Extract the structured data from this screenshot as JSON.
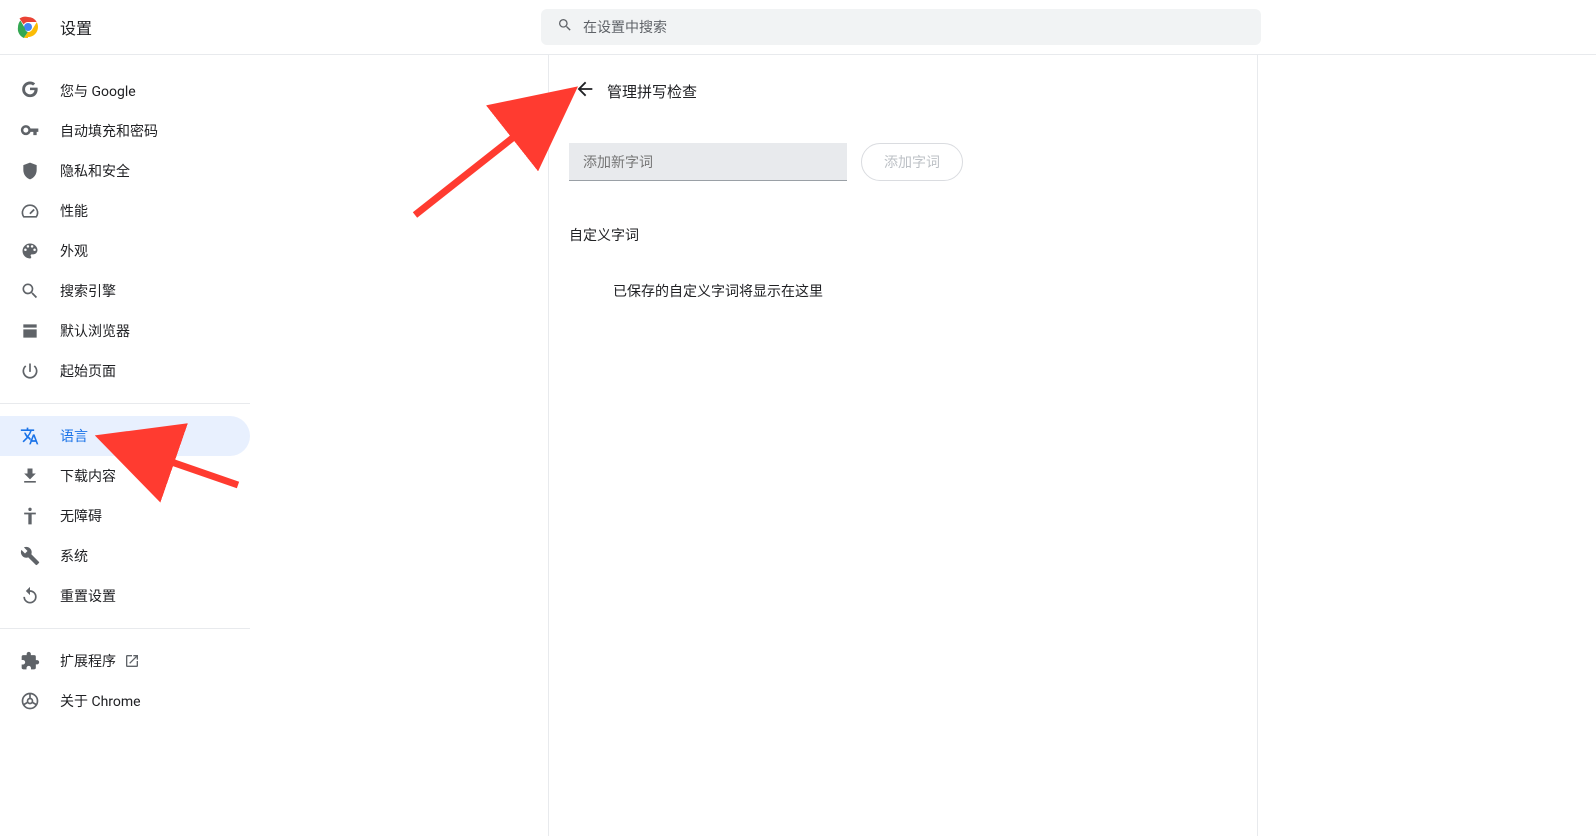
{
  "header": {
    "title": "设置",
    "search_placeholder": "在设置中搜索"
  },
  "sidebar": {
    "items": [
      {
        "id": "you-google",
        "label": "您与 Google",
        "icon": "google"
      },
      {
        "id": "autofill",
        "label": "自动填充和密码",
        "icon": "key"
      },
      {
        "id": "privacy",
        "label": "隐私和安全",
        "icon": "shield"
      },
      {
        "id": "performance",
        "label": "性能",
        "icon": "speed"
      },
      {
        "id": "appearance",
        "label": "外观",
        "icon": "palette"
      },
      {
        "id": "search-engine",
        "label": "搜索引擎",
        "icon": "search"
      },
      {
        "id": "default-browser",
        "label": "默认浏览器",
        "icon": "browser"
      },
      {
        "id": "startup",
        "label": "起始页面",
        "icon": "power"
      },
      {
        "id": "languages",
        "label": "语言",
        "icon": "translate",
        "active": true
      },
      {
        "id": "downloads",
        "label": "下载内容",
        "icon": "download"
      },
      {
        "id": "accessibility",
        "label": "无障碍",
        "icon": "accessibility"
      },
      {
        "id": "system",
        "label": "系统",
        "icon": "wrench"
      },
      {
        "id": "reset",
        "label": "重置设置",
        "icon": "reset"
      }
    ],
    "footer": [
      {
        "id": "extensions",
        "label": "扩展程序",
        "icon": "extension",
        "external": true
      },
      {
        "id": "about",
        "label": "关于 Chrome",
        "icon": "chrome"
      }
    ]
  },
  "page": {
    "title": "管理拼写检查",
    "add_placeholder": "添加新字词",
    "add_button": "添加字词",
    "custom_words_label": "自定义字词",
    "empty_message": "已保存的自定义字词将显示在这里"
  }
}
